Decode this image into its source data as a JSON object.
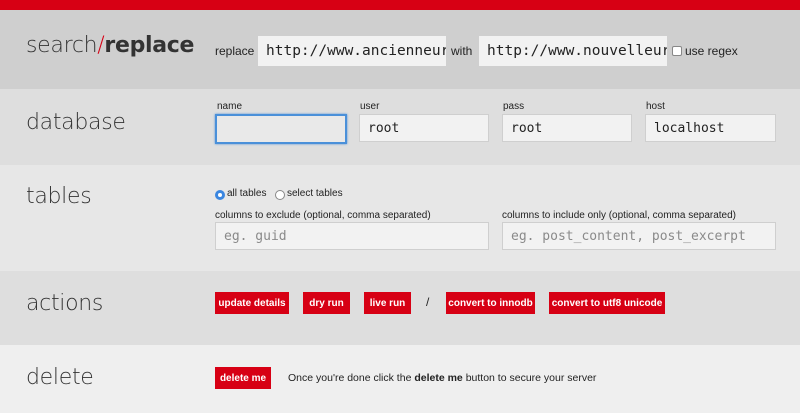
{
  "search_replace": {
    "title_search": "search/",
    "title_replace": "replace",
    "replace_label": "replace",
    "replace_value": "http://www.ancienneurl.",
    "with_label": "with",
    "with_value": "http://www.nouvelleurl.",
    "regex_label": "use regex",
    "regex_checked": false
  },
  "database": {
    "title": "database",
    "name_label": "name",
    "name_value": "",
    "user_label": "user",
    "user_value": "root",
    "pass_label": "pass",
    "pass_value": "root",
    "host_label": "host",
    "host_value": "localhost"
  },
  "tables": {
    "title": "tables",
    "all_tables_label": "all tables",
    "select_tables_label": "select tables",
    "selected": "all tables",
    "exclude_label": "columns to exclude (optional, comma separated)",
    "exclude_placeholder": "eg. guid",
    "include_label": "columns to include only (optional, comma separated)",
    "include_placeholder": "eg. post_content, post_excerpt"
  },
  "actions": {
    "title": "actions",
    "update_details": "update details",
    "dry_run": "dry run",
    "live_run": "live run",
    "separator": "/",
    "convert_innodb": "convert to innodb",
    "convert_utf8": "convert to utf8 unicode"
  },
  "delete": {
    "title": "delete",
    "button": "delete me",
    "note_prefix": "Once you're done click the ",
    "note_bold": "delete me",
    "note_suffix": " button to secure your server"
  },
  "colors": {
    "accent": "#d70014",
    "focus": "#4a90d9"
  }
}
